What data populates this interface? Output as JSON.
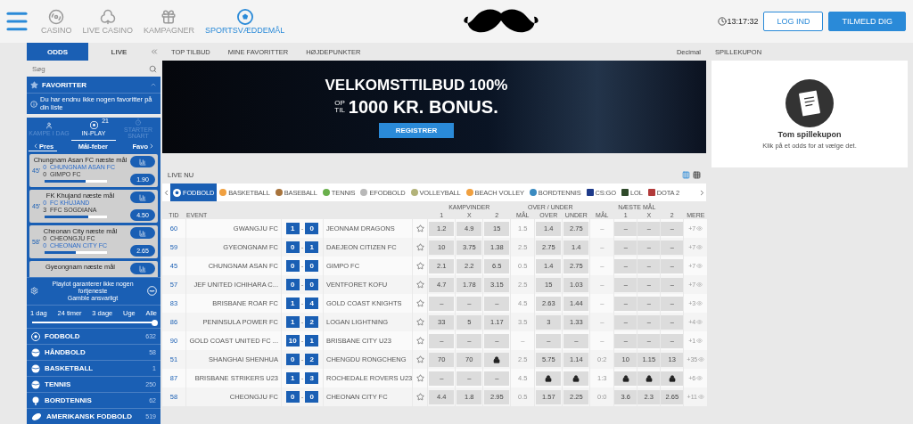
{
  "header": {
    "nav": [
      {
        "kind": "chip",
        "label": "CASINO",
        "selected": false
      },
      {
        "kind": "cards",
        "label": "LIVE CASINO",
        "selected": false
      },
      {
        "kind": "gift",
        "label": "KAMPAGNER",
        "selected": false
      },
      {
        "kind": "ball",
        "label": "SPORTSVÆDDEMÅL",
        "selected": true
      }
    ],
    "clock": "13:17:32",
    "login": "LOG IND",
    "signup": "TILMELD DIG"
  },
  "sidebar": {
    "tabs": [
      {
        "label": "ODDS",
        "selected": true
      },
      {
        "label": "LIVE",
        "selected": false
      }
    ],
    "search": {
      "placeholder": "Søg"
    },
    "favorites": {
      "title": "FAVORITTER",
      "info": "Du har endnu ikke nogen favoritter på din liste"
    },
    "inplay": {
      "tabs": [
        {
          "label": "KAMPE I DAG",
          "selected": false
        },
        {
          "label": "IN-PLAY",
          "selected": true,
          "badge": "21"
        },
        {
          "label": "STARTER SNART",
          "selected": false
        }
      ],
      "subtabs": [
        {
          "label": "Pres",
          "selected": true
        },
        {
          "label": "Mål-feber",
          "selected": false
        },
        {
          "label": "Favo",
          "selected": false
        }
      ],
      "cards": [
        {
          "title": "Chungnam Asan FC næste mål",
          "minute": "45'",
          "teams": [
            {
              "score": "0",
              "name": "CHUNGNAM ASAN FC",
              "highlight": true
            },
            {
              "score": "0",
              "name": "GIMPO FC",
              "highlight": false
            }
          ],
          "odds": "1.90",
          "level": 0.65
        },
        {
          "title": "FK Khujand næste mål",
          "minute": "45'",
          "teams": [
            {
              "score": "0",
              "name": "FC KHUJAND",
              "highlight": true
            },
            {
              "score": "3",
              "name": "FFC SOGDIANA",
              "highlight": false
            }
          ],
          "odds": "4.50",
          "level": 0.7
        },
        {
          "title": "Cheonan City næste mål",
          "minute": "58'",
          "teams": [
            {
              "score": "0",
              "name": "CHEONGJU FC",
              "highlight": false
            },
            {
              "score": "0",
              "name": "CHEONAN CITY FC",
              "highlight": true
            }
          ],
          "odds": "2.65",
          "level": 0.5
        },
        {
          "title": "Gyeongnam næste mål"
        }
      ]
    },
    "promo": {
      "lines": [
        "Playlot garanterer ikke nogen fortjeneste",
        "Gamble ansvarligt"
      ]
    },
    "filter": {
      "options": [
        "1 dag",
        "24 timer",
        "3 dage",
        "Uge",
        "Alle"
      ],
      "level": 1
    },
    "sports": [
      {
        "kind": "ball",
        "label": "FODBOLD",
        "count": "632"
      },
      {
        "kind": "handball",
        "label": "HÅNDBOLD",
        "count": "58"
      },
      {
        "kind": "basket",
        "label": "BASKETBALL",
        "count": "1"
      },
      {
        "kind": "tennis",
        "label": "TENNIS",
        "count": "250"
      },
      {
        "kind": "pingpong",
        "label": "BORDTENNIS",
        "count": "62"
      },
      {
        "kind": "football",
        "label": "AMERIKANSK FODBOLD",
        "count": "519"
      }
    ]
  },
  "main": {
    "tabs": [
      {
        "label": "TOP TILBUD",
        "selected": false
      },
      {
        "label": "MINE FAVORITTER",
        "selected": false
      },
      {
        "label": "HØJDEPUNKTER",
        "selected": false
      }
    ],
    "odds_format": "Decimal",
    "banner": {
      "headline": "VELKOMSTTILBUD 100%",
      "prefix": [
        "OP",
        "TIL"
      ],
      "bonus": "1000 KR. BONUS.",
      "button": "REGISTRER"
    },
    "live": {
      "title": "LIVE NU",
      "views": [
        {
          "selected": true
        },
        {
          "selected": false
        }
      ]
    },
    "sport_tabs": [
      {
        "kind": "ball",
        "label": "FODBOLD",
        "selected": true,
        "color": "#ffffff"
      },
      {
        "kind": "dot",
        "label": "BASKETBALL",
        "selected": false,
        "color": "#f0a040"
      },
      {
        "kind": "dot",
        "label": "BASEBALL",
        "selected": false,
        "color": "#a8743c"
      },
      {
        "kind": "dot",
        "label": "TENNIS",
        "selected": false,
        "color": "#6ab04c"
      },
      {
        "kind": "dot",
        "label": "EFODBOLD",
        "selected": false,
        "color": "#b8b8b8"
      },
      {
        "kind": "dot",
        "label": "VOLLEYBALL",
        "selected": false,
        "color": "#b3b37a"
      },
      {
        "kind": "dot",
        "label": "BEACH VOLLEY",
        "selected": false,
        "color": "#f0a040"
      },
      {
        "kind": "dot",
        "label": "BORDTENNIS",
        "selected": false,
        "color": "#3a8ac0"
      },
      {
        "kind": "logo",
        "label": "CS:GO",
        "selected": false,
        "color": "#1e3a8a"
      },
      {
        "kind": "logo",
        "label": "LOL",
        "selected": false,
        "color": "#2f4a2a"
      },
      {
        "kind": "logo",
        "label": "DOTA 2",
        "selected": false,
        "color": "#b23a3a"
      }
    ],
    "table": {
      "groups": [
        "KAMPVINDER",
        "OVER / UNDER",
        "NÆSTE MÅL"
      ],
      "columns": [
        "TID",
        "EVENT",
        "1",
        "X",
        "2",
        "MÅL",
        "OVER",
        "UNDER",
        "MÅL",
        "1",
        "X",
        "2",
        "MERE"
      ],
      "score_separator": "-",
      "rows": [
        {
          "time": "60",
          "home": "GWANGJU FC",
          "home_score": "1",
          "away_score": "0",
          "away": "JEONNAM DRAGONS",
          "win": [
            "1.2",
            "4.9",
            "15"
          ],
          "line": "1.5",
          "ou": [
            "1.4",
            "2.75"
          ],
          "next_line": "–",
          "next": [
            "–",
            "–",
            "–"
          ],
          "more": "+7"
        },
        {
          "time": "59",
          "home": "GYEONGNAM FC",
          "home_score": "0",
          "away_score": "1",
          "away": "DAEJEON CITIZEN FC",
          "win": [
            "10",
            "3.75",
            "1.38"
          ],
          "line": "2.5",
          "ou": [
            "2.75",
            "1.4"
          ],
          "next_line": "–",
          "next": [
            "–",
            "–",
            "–"
          ],
          "more": "+7"
        },
        {
          "time": "45",
          "home": "CHUNGNAM ASAN FC",
          "home_score": "0",
          "away_score": "0",
          "away": "GIMPO FC",
          "win": [
            "2.1",
            "2.2",
            "6.5"
          ],
          "line": "0.5",
          "ou": [
            "1.4",
            "2.75"
          ],
          "next_line": "–",
          "next": [
            "–",
            "–",
            "–"
          ],
          "more": "+7"
        },
        {
          "time": "57",
          "home": "JEF UNITED ICHIHARA C...",
          "home_score": "0",
          "away_score": "0",
          "away": "VENTFORET KOFU",
          "win": [
            "4.7",
            "1.78",
            "3.15"
          ],
          "line": "2.5",
          "ou": [
            "15",
            "1.03"
          ],
          "next_line": "–",
          "next": [
            "–",
            "–",
            "–"
          ],
          "more": "+7"
        },
        {
          "time": "83",
          "home": "BRISBANE ROAR FC",
          "home_score": "1",
          "away_score": "4",
          "away": "GOLD COAST KNIGHTS",
          "win": [
            "–",
            "–",
            "–"
          ],
          "line": "4.5",
          "ou": [
            "2.63",
            "1.44"
          ],
          "next_line": "–",
          "next": [
            "–",
            "–",
            "–"
          ],
          "more": "+3"
        },
        {
          "time": "86",
          "home": "PENINSULA POWER FC",
          "home_score": "1",
          "away_score": "2",
          "away": "LOGAN LIGHTNING",
          "win": [
            "33",
            "5",
            "1.17"
          ],
          "line": "3.5",
          "ou": [
            "3",
            "1.33"
          ],
          "next_line": "–",
          "next": [
            "–",
            "–",
            "–"
          ],
          "more": "+4"
        },
        {
          "time": "90",
          "home": "GOLD COAST UNITED FC ...",
          "home_score": "10",
          "away_score": "1",
          "away": "BRISBANE CITY U23",
          "win": [
            "–",
            "–",
            "–"
          ],
          "line": "–",
          "ou": [
            "–",
            "–"
          ],
          "next_line": "–",
          "next": [
            "–",
            "–",
            "–"
          ],
          "more": "+1"
        },
        {
          "time": "51",
          "home": "SHANGHAI SHENHUA",
          "home_score": "0",
          "away_score": "2",
          "away": "CHENGDU RONGCHENG",
          "win": [
            "70",
            "70",
            {
              "kind": "lock"
            }
          ],
          "line": "2.5",
          "ou": [
            "5.75",
            "1.14"
          ],
          "next_line": "0:2",
          "next": [
            "10",
            "1.15",
            "13"
          ],
          "more": "+35"
        },
        {
          "time": "87",
          "home": "BRISBANE STRIKERS U23",
          "home_score": "1",
          "away_score": "3",
          "away": "ROCHEDALE ROVERS U23",
          "win": [
            "–",
            "–",
            "–"
          ],
          "line": "4.5",
          "ou": [
            {
              "kind": "lock"
            },
            {
              "kind": "lock"
            }
          ],
          "next_line": "1:3",
          "next": [
            {
              "kind": "lock"
            },
            {
              "kind": "lock"
            },
            {
              "kind": "lock"
            }
          ],
          "more": "+6"
        },
        {
          "time": "58",
          "home": "CHEONGJU FC",
          "home_score": "0",
          "away_score": "0",
          "away": "CHEONAN CITY FC",
          "win": [
            "4.4",
            "1.8",
            "2.95"
          ],
          "line": "0.5",
          "ou": [
            "1.57",
            "2.25"
          ],
          "next_line": "0:0",
          "next": [
            "3.6",
            "2.3",
            "2.65"
          ],
          "more": "+11"
        }
      ]
    }
  },
  "coupon": {
    "title": "SPILLEKUPON",
    "empty_title": "Tom spillekupon",
    "empty_text": "Klik på et odds for at vælge det."
  }
}
